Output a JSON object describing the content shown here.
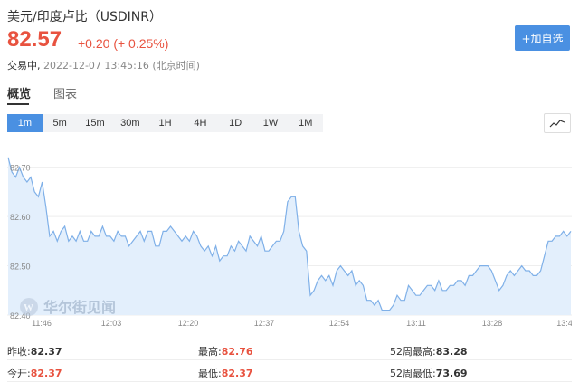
{
  "header": {
    "title": "美元/印度卢比（USDINR）",
    "price": "82.57",
    "change": "+0.20 (+ 0.25%)",
    "status": "交易中,",
    "time": "2022-12-07 13:45:16 (北京时间)",
    "add_button": "+加自选"
  },
  "tabs": [
    "概览",
    "图表"
  ],
  "periods": [
    "1m",
    "5m",
    "15m",
    "30m",
    "1H",
    "4H",
    "1D",
    "1W",
    "1M"
  ],
  "active_period": "1m",
  "watermark": "华尔街见闻",
  "colors": {
    "up": "#e8523f",
    "accent": "#4a90e2",
    "line": "#7fb0e8",
    "fill": "#e3effc"
  },
  "chart_data": {
    "type": "area",
    "x_ticks": [
      "11:46",
      "12:03",
      "12:20",
      "12:37",
      "12:54",
      "13:11",
      "13:28",
      "13:4"
    ],
    "y_ticks": [
      "82.70",
      "82.60",
      "82.50",
      "82.40"
    ],
    "ylim": [
      82.4,
      82.76
    ],
    "x": [
      0,
      1,
      2,
      3,
      4,
      5,
      6,
      7,
      8,
      9,
      10,
      11,
      12,
      13,
      14,
      15,
      16,
      17,
      18,
      19,
      20,
      21,
      22,
      23,
      24,
      25,
      26,
      27,
      28,
      29,
      30,
      31,
      32,
      33,
      34,
      35,
      36,
      37,
      38,
      39,
      40,
      41,
      42,
      43,
      44,
      45,
      46,
      47,
      48,
      49,
      50,
      51,
      52,
      53,
      54,
      55,
      56,
      57,
      58,
      59,
      60,
      61,
      62,
      63,
      64,
      65,
      66,
      67,
      68,
      69,
      70,
      71,
      72,
      73,
      74,
      75,
      76,
      77,
      78,
      79,
      80,
      81,
      82,
      83,
      84,
      85,
      86,
      87,
      88,
      89,
      90,
      91,
      92,
      93,
      94,
      95,
      96,
      97,
      98,
      99,
      100,
      101,
      102,
      103,
      104,
      105,
      106,
      107,
      108,
      109,
      110,
      111,
      112,
      113,
      114,
      115,
      116,
      117,
      118,
      119,
      120,
      121,
      122,
      123,
      124,
      125,
      126,
      127,
      128,
      129,
      130,
      131,
      132,
      133,
      134,
      135,
      136,
      137,
      138,
      139,
      140,
      141,
      142,
      143,
      144,
      145,
      146,
      147,
      148,
      149
    ],
    "values": [
      82.72,
      82.69,
      82.68,
      82.7,
      82.68,
      82.67,
      82.68,
      82.65,
      82.64,
      82.67,
      82.62,
      82.56,
      82.57,
      82.55,
      82.57,
      82.58,
      82.55,
      82.56,
      82.55,
      82.57,
      82.55,
      82.55,
      82.57,
      82.56,
      82.56,
      82.58,
      82.56,
      82.56,
      82.55,
      82.57,
      82.56,
      82.56,
      82.54,
      82.55,
      82.56,
      82.57,
      82.55,
      82.57,
      82.57,
      82.54,
      82.54,
      82.57,
      82.57,
      82.58,
      82.57,
      82.56,
      82.55,
      82.56,
      82.55,
      82.57,
      82.56,
      82.54,
      82.53,
      82.54,
      82.52,
      82.54,
      82.51,
      82.52,
      82.52,
      82.54,
      82.53,
      82.55,
      82.54,
      82.53,
      82.56,
      82.55,
      82.54,
      82.56,
      82.53,
      82.53,
      82.54,
      82.55,
      82.55,
      82.57,
      82.63,
      82.64,
      82.64,
      82.57,
      82.54,
      82.53,
      82.44,
      82.45,
      82.47,
      82.48,
      82.47,
      82.48,
      82.46,
      82.49,
      82.5,
      82.49,
      82.48,
      82.49,
      82.46,
      82.47,
      82.46,
      82.43,
      82.43,
      82.42,
      82.43,
      82.41,
      82.41,
      82.41,
      82.42,
      82.44,
      82.43,
      82.43,
      82.46,
      82.45,
      82.44,
      82.44,
      82.45,
      82.46,
      82.46,
      82.45,
      82.47,
      82.45,
      82.45,
      82.46,
      82.46,
      82.47,
      82.47,
      82.46,
      82.48,
      82.48,
      82.49,
      82.5,
      82.5,
      82.5,
      82.49,
      82.47,
      82.45,
      82.46,
      82.48,
      82.49,
      82.48,
      82.49,
      82.5,
      82.49,
      82.49,
      82.48,
      82.48,
      82.49,
      82.52,
      82.55,
      82.55,
      82.56,
      82.56,
      82.57,
      82.56,
      82.57
    ]
  },
  "stats": {
    "row1": [
      {
        "label": "昨收:",
        "value": "82.37",
        "color": "black"
      },
      {
        "label": "最高:",
        "value": "82.76",
        "color": "red"
      },
      {
        "label": "52周最高:",
        "value": "83.28",
        "color": "black"
      }
    ],
    "row2": [
      {
        "label": "今开:",
        "value": "82.37",
        "color": "red"
      },
      {
        "label": "最低:",
        "value": "82.37",
        "color": "red"
      },
      {
        "label": "52周最低:",
        "value": "73.69",
        "color": "black"
      }
    ]
  }
}
